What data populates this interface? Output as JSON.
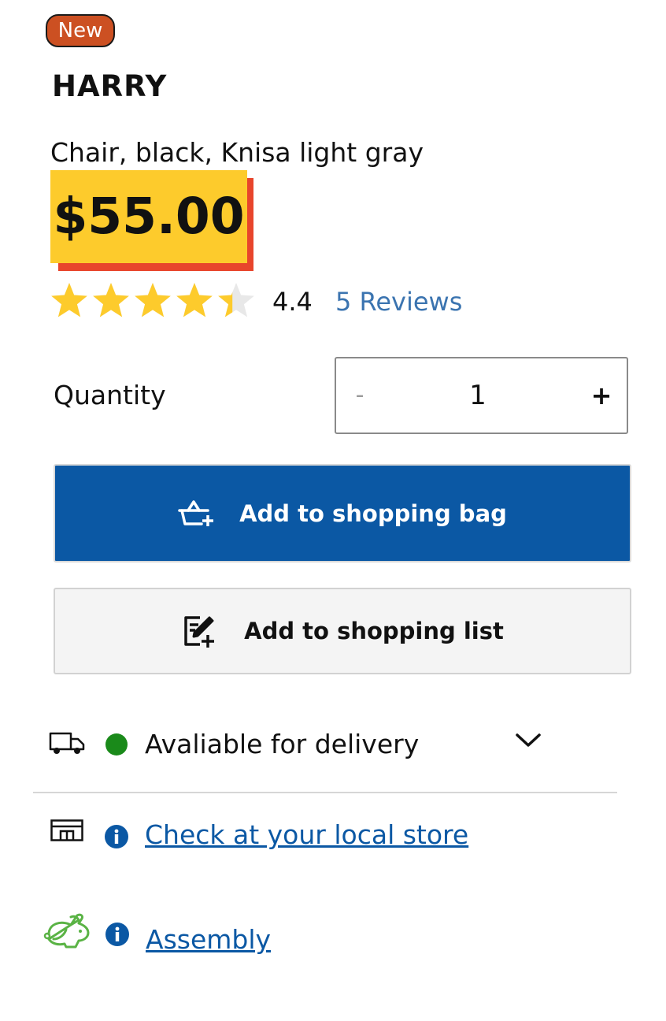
{
  "product": {
    "badge": "New",
    "name": "HARRY",
    "description": "Chair, black, Knisa light gray",
    "price": "$55.00"
  },
  "rating": {
    "stars": 4.4,
    "max_stars": 5,
    "value_label": "4.4",
    "reviews_label": "5 Reviews"
  },
  "quantity": {
    "label": "Quantity",
    "minus_label": "-",
    "value": "1",
    "plus_label": "+"
  },
  "actions": {
    "add_to_bag_label": "Add to shopping bag",
    "add_to_list_label": "Add to shopping list"
  },
  "availability": {
    "delivery_label": "Avaliable for delivery",
    "store_link_label": "Check at your local store",
    "assembly_link_label": "Assembly"
  },
  "icons": {
    "bag": "shopping-basket-plus-icon",
    "list": "note-edit-plus-icon",
    "delivery": "truck-icon",
    "status": "green-dot",
    "expand": "chevron-down-icon",
    "store": "store-icon",
    "info": "info-icon",
    "assembly": "rabbit-icon"
  },
  "colors": {
    "badge_bg": "#cc5022",
    "price_bg": "#fdcb2c",
    "price_shadow": "#e8452c",
    "star": "#fdcb2c",
    "star_empty": "#e8e8e8",
    "primary_button": "#0b58a4",
    "link": "#0b58a4",
    "reviews_link": "#3b74b0",
    "available_green": "#1a8a1a",
    "assembly_green": "#5ab345"
  }
}
